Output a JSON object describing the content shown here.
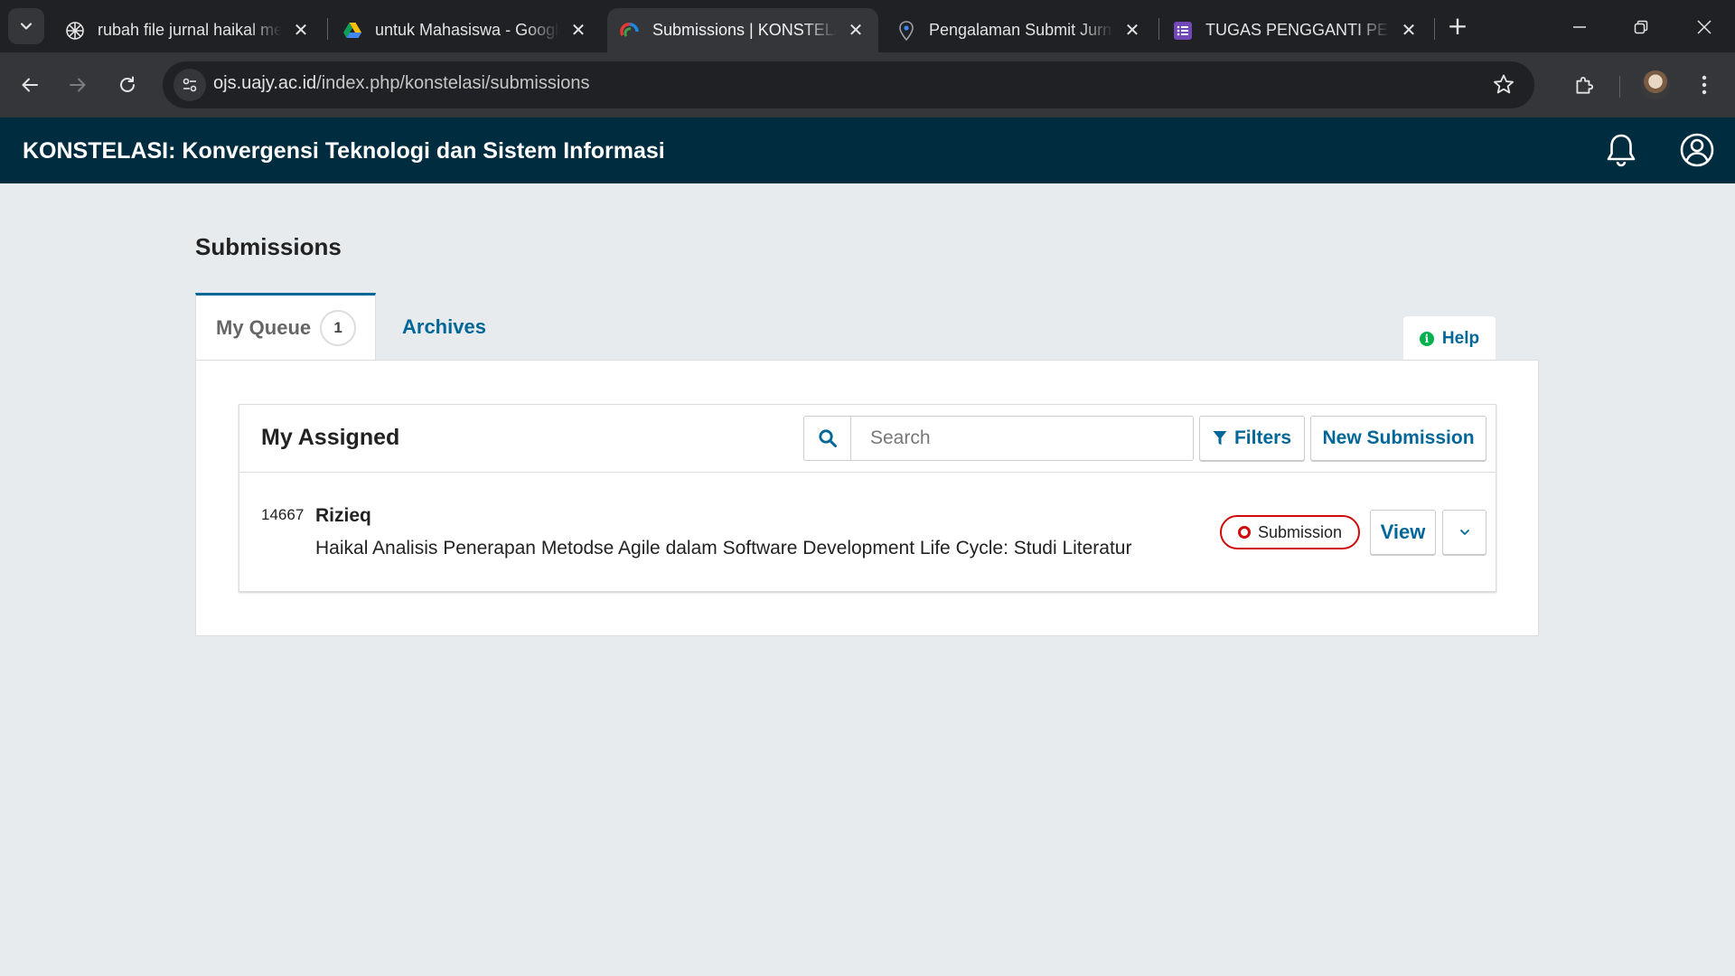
{
  "browser": {
    "tabs": [
      {
        "title": "rubah file jurnal haikal menjadi",
        "icon": "pinwheel-favicon",
        "active": false
      },
      {
        "title": "untuk Mahasiswa - Google Drive",
        "icon": "google-drive-favicon",
        "active": false
      },
      {
        "title": "Submissions | KONSTELASI",
        "icon": "ojs-favicon",
        "active": true
      },
      {
        "title": "Pengalaman Submit Jurnal",
        "icon": "maps-pin-favicon",
        "active": false
      },
      {
        "title": "TUGAS PENGGANTI PERTEMUAN",
        "icon": "google-forms-favicon",
        "active": false
      }
    ],
    "url": {
      "domain": "ojs.uajy.ac.id",
      "path": "/index.php/konstelasi/submissions"
    }
  },
  "site": {
    "title": "KONSTELASI: Konvergensi Teknologi dan Sistem Informasi"
  },
  "page": {
    "title": "Submissions",
    "tabs": [
      {
        "label": "My Queue",
        "count": "1"
      },
      {
        "label": "Archives"
      }
    ],
    "help_label": "Help"
  },
  "list": {
    "title": "My Assigned",
    "search_placeholder": "Search",
    "filters_label": "Filters",
    "new_submission_label": "New Submission",
    "items": [
      {
        "id": "14667",
        "author": "Rizieq",
        "title": "Haikal Analisis Penerapan Metodse Agile dalam Software Development Life Cycle: Studi Literatur",
        "stage": "Submission",
        "view_label": "View"
      }
    ]
  },
  "colors": {
    "header_bg": "#002c40",
    "primary": "#006798",
    "stage_submission": "#d00a0a",
    "help_icon": "#00b24e",
    "page_bg": "#e8ebed"
  }
}
